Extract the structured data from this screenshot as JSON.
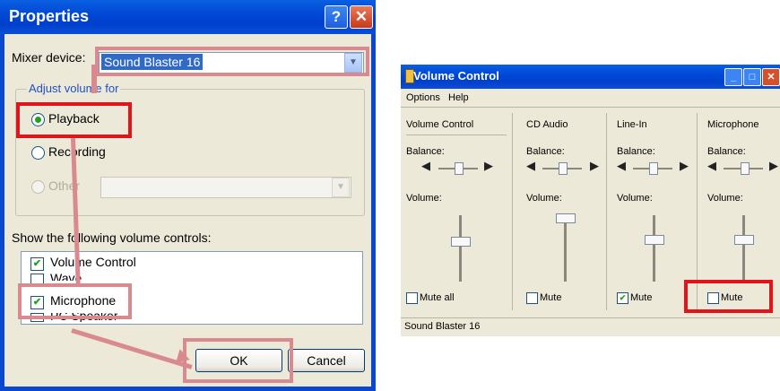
{
  "properties": {
    "title": "Properties",
    "mixer_device_label": "Mixer device:",
    "mixer_device_value": "Sound Blaster 16",
    "adjust_group_label": "Adjust volume for",
    "radio_playback": "Playback",
    "radio_recording": "Recording",
    "radio_other": "Other",
    "show_controls_label": "Show the following volume controls:",
    "controls": [
      {
        "label": "Volume Control",
        "checked": true
      },
      {
        "label": "Wave",
        "checked": false
      },
      {
        "label": "Microphone",
        "checked": true
      },
      {
        "label": "PC Speaker",
        "checked": false
      }
    ],
    "ok_label": "OK",
    "cancel_label": "Cancel"
  },
  "volume_control": {
    "title": "Volume Control",
    "menu": [
      "Options",
      "Help"
    ],
    "balance_label": "Balance:",
    "volume_label": "Volume:",
    "channels": [
      {
        "name": "Volume Control",
        "mute_label": "Mute all",
        "muted": false
      },
      {
        "name": "CD Audio",
        "mute_label": "Mute",
        "muted": false
      },
      {
        "name": "Line-In",
        "mute_label": "Mute",
        "muted": true
      },
      {
        "name": "Microphone",
        "mute_label": "Mute",
        "muted": false
      }
    ],
    "status": "Sound Blaster 16"
  },
  "colors": {
    "highlight_red": "#e0141a",
    "highlight_pink": "#d98a8e",
    "xp_blue": "#0046d6"
  }
}
